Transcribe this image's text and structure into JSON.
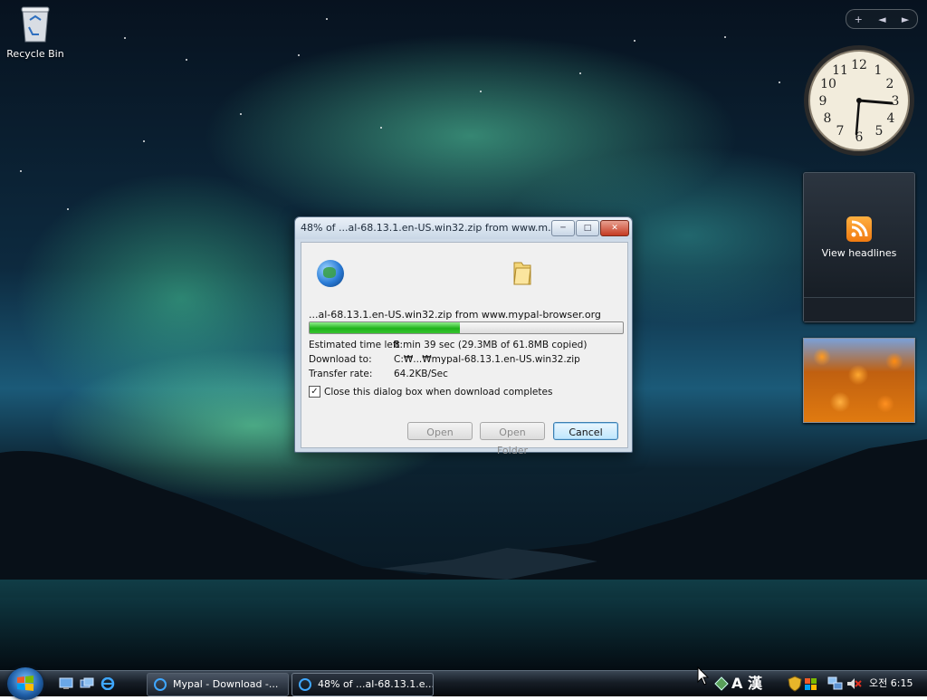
{
  "desktop": {
    "icons": [
      {
        "label": "Recycle Bin"
      }
    ]
  },
  "sidebar": {
    "controls": {
      "add": "+",
      "prev": "◄",
      "next": "►"
    },
    "clock": {
      "numbers": [
        "12",
        "1",
        "2",
        "3",
        "4",
        "5",
        "6",
        "7",
        "8",
        "9",
        "10",
        "11"
      ]
    },
    "headlines": {
      "label": "View headlines"
    }
  },
  "dialog": {
    "title": "48% of ...al-68.13.1.en-US.win32.zip from www.m...",
    "source": "...al-68.13.1.en-US.win32.zip from www.mypal-browser.org",
    "progress": 0.48,
    "rows": [
      {
        "key": "Estimated time left:",
        "value": "8 min 39 sec (29.3MB of 61.8MB copied)"
      },
      {
        "key": "Download to:",
        "value": "C:₩...₩mypal-68.13.1.en-US.win32.zip"
      },
      {
        "key": "Transfer rate:",
        "value": "64.2KB/Sec"
      }
    ],
    "close_when_done": {
      "label": "Close this dialog box when download completes",
      "checked": true,
      "mark": "✓"
    },
    "buttons": {
      "open": "Open",
      "open_folder": "Open Folder",
      "cancel": "Cancel"
    },
    "controls": {
      "minimize": "─",
      "maximize": "□",
      "close": "✕"
    }
  },
  "taskbar": {
    "tasks": [
      {
        "label": "Mypal - Download -..."
      },
      {
        "label": "48% of ...al-68.13.1.e..."
      }
    ],
    "tray": {
      "ime_a": "A",
      "ime_han": "漢",
      "time": "오전 6:15"
    }
  },
  "colors": {
    "progress": "#1fb21b",
    "accent": "#3c7fb1"
  }
}
